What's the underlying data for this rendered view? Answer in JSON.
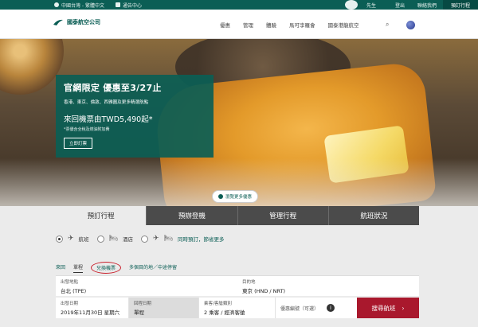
{
  "topbar": {
    "region": "中國台灣 - 繁體中文",
    "announcement": "通告中心",
    "greeting": "先生",
    "logout": "登出",
    "contact": "聯絡我們",
    "book": "預訂行程"
  },
  "nav": {
    "logo_text": "國泰航空公司",
    "menu": [
      "優惠",
      "管理",
      "體驗",
      "馬可孛羅會",
      "國泰港龍航空"
    ]
  },
  "promo": {
    "headline": "官網限定 優惠至3/27止",
    "destinations": "香港、東京、倫敦、西雅圖及更多精選航點",
    "price": "來回機票由TWD5,490起*",
    "note": "*票價含全稅及燃油附加費",
    "cta": "立即訂票"
  },
  "more_offers": "瀏覽更多優惠",
  "tabs": [
    "預訂行程",
    "預辦登機",
    "管理行程",
    "航班狀況"
  ],
  "booking_type": [
    {
      "label": "航班",
      "selected": true
    },
    {
      "label": "酒店",
      "selected": false
    },
    {
      "label": "同時預訂，節省更多",
      "selected": false
    }
  ],
  "trip_types": [
    "來回",
    "單程",
    "兌換機票",
    "多個目的地／中途停留"
  ],
  "fields": {
    "from_label": "出發地點",
    "from_value": "台北 (TPE)",
    "to_label": "目的地",
    "to_value": "東京 (HND / NRT)",
    "depart_label": "出發日期",
    "depart_value": "2019年11月30日 星期六",
    "return_label": "回程日期",
    "return_value": "單程",
    "pax_label": "乘客/客艙類別",
    "pax_value": "2 乘客 / 經濟客艙",
    "promo_label": "優惠編號（可選）"
  },
  "search_button": "搜尋航班",
  "colors": {
    "brand": "#0b5e55",
    "cta": "#a9182d"
  }
}
